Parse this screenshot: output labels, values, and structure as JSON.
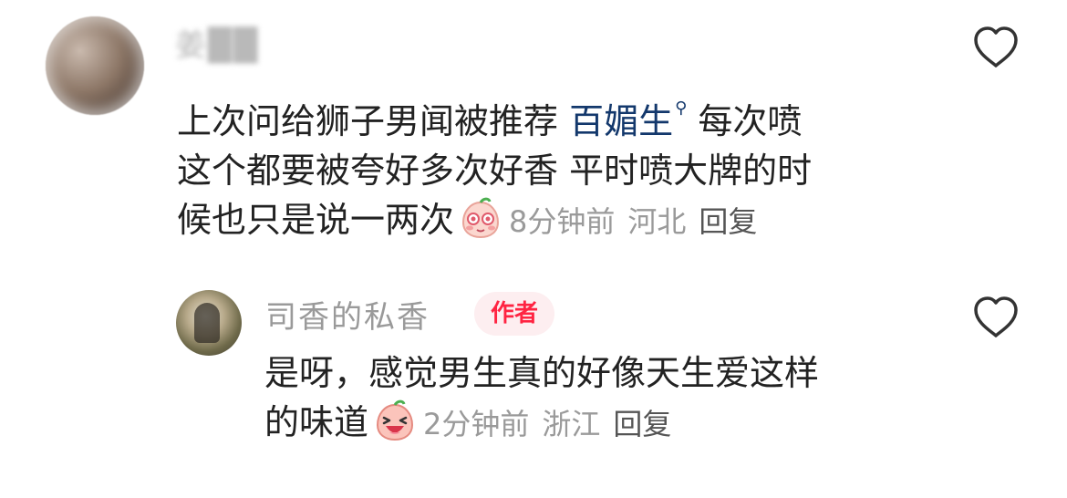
{
  "comment": {
    "username": "姜██",
    "text_lines": [
      "上次问给狮子男闻被推荐 ",
      "这个都要被夸好多次好香 平时喷大牌的时",
      "候也只是说一两次"
    ],
    "hashtag": "百媚生",
    "text_after_hashtag": " 每次喷",
    "time": "8分钟前",
    "location": "河北",
    "reply_label": "回复",
    "emoji": "shy-peach-emoji"
  },
  "reply": {
    "username": "司香的私香",
    "badge": "作者",
    "text_lines": [
      "是呀，感觉男生真的好像天生爱这样",
      "的味道"
    ],
    "time": "2分钟前",
    "location": "浙江",
    "reply_label": "回复",
    "emoji": "laughing-peach-emoji"
  },
  "colors": {
    "hashtag": "#13386c",
    "author_badge_text": "#ff2442",
    "author_badge_bg": "#fdeef0",
    "meta": "#9a9a9a"
  }
}
